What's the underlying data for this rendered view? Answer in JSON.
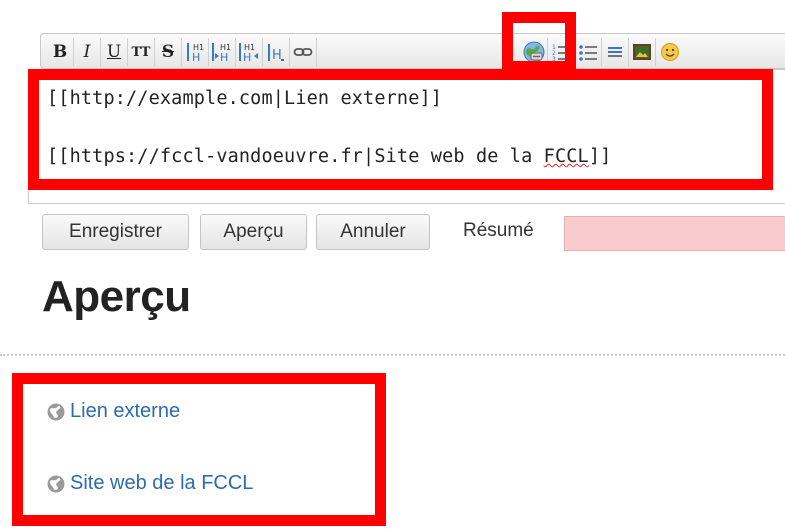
{
  "toolbar": {
    "buttons": [
      {
        "name": "bold-button",
        "label": "B"
      },
      {
        "name": "italic-button",
        "label": "I"
      },
      {
        "name": "underline-button",
        "label": "U"
      },
      {
        "name": "monospace-button",
        "label": "TT"
      },
      {
        "name": "strikethrough-button",
        "label": "S"
      }
    ],
    "icons": [
      "heading-same-level-icon",
      "heading-lower-level-icon",
      "heading-higher-level-icon",
      "heading-menu-icon",
      "link-icon",
      "external-link-icon",
      "ordered-list-icon",
      "unordered-list-icon",
      "horizontal-rule-icon",
      "image-icon",
      "smiley-icon"
    ]
  },
  "editor": {
    "line1": "[[http://example.com|Lien externe]]",
    "line2_before": "[[https://fccl-vandoeuvre.fr|Site web de la ",
    "line2_misspelled": "FCCL",
    "line2_after": "]]"
  },
  "actions": {
    "save_label": "Enregistrer",
    "preview_label": "Aperçu",
    "cancel_label": "Annuler",
    "summary_label": "Résumé",
    "summary_value": ""
  },
  "preview": {
    "title": "Aperçu",
    "links": [
      {
        "text": "Lien externe"
      },
      {
        "text": "Site web de la FCCL"
      }
    ]
  },
  "colors": {
    "highlight": "#ff0000",
    "link": "#2b6cb0",
    "summary_bg": "#f8cccc"
  }
}
